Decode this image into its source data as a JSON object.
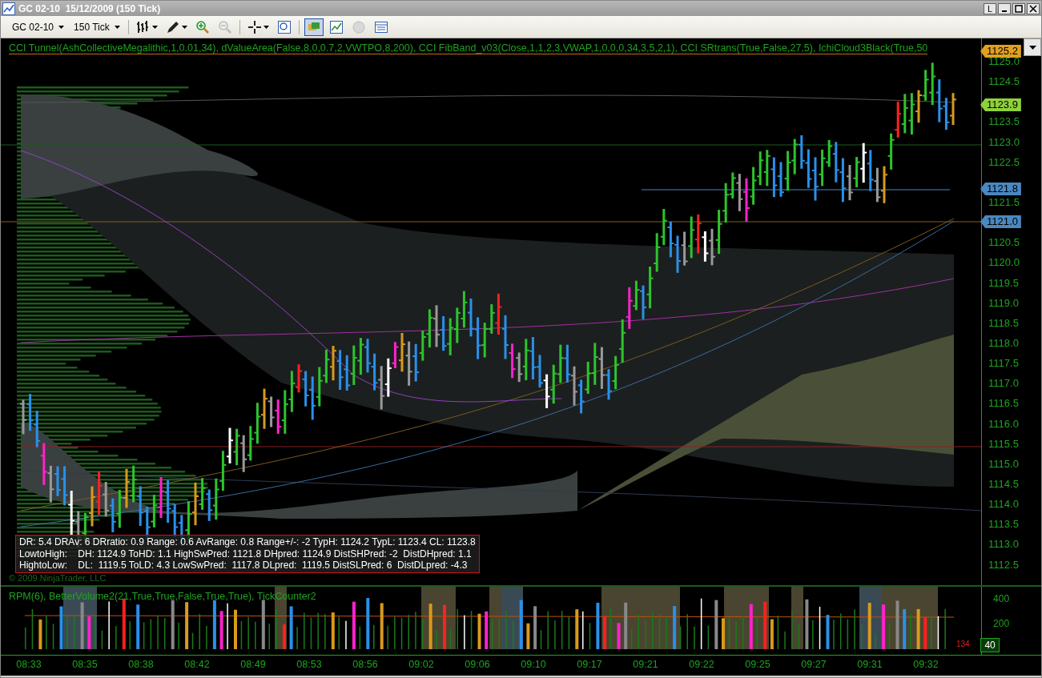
{
  "window": {
    "title": "GC 02-10  15/12/2009 (150 Tick)",
    "link_button": "L"
  },
  "toolbar": {
    "instrument": "GC 02-10",
    "interval": "150 Tick",
    "tools": [
      {
        "kind": "bars",
        "dropdown": true,
        "selected": false,
        "disabled": false
      },
      {
        "kind": "pencil",
        "dropdown": true,
        "selected": false,
        "disabled": false
      },
      {
        "kind": "zoom-in",
        "dropdown": false,
        "selected": false,
        "disabled": false
      },
      {
        "kind": "zoom-out",
        "dropdown": false,
        "selected": false,
        "disabled": true
      },
      {
        "kind": "crosshair",
        "dropdown": true,
        "selected": false,
        "disabled": false
      },
      {
        "kind": "zoom-box",
        "dropdown": false,
        "selected": false,
        "disabled": false
      },
      {
        "kind": "data-box",
        "dropdown": false,
        "selected": true,
        "disabled": false
      },
      {
        "kind": "chart",
        "dropdown": false,
        "selected": false,
        "disabled": false
      },
      {
        "kind": "coin",
        "dropdown": false,
        "selected": false,
        "disabled": true
      },
      {
        "kind": "table",
        "dropdown": false,
        "selected": false,
        "disabled": false
      }
    ]
  },
  "price_panel": {
    "indicators": "CCI Tunnel(AshCollectiveMegalithic,1,0.01,34),  dValueArea(False,8,0,0.7,2,VWTPO,8,200),  CCI FibBand_v03(Close,1,1,2,3,VWAP,1,0,0,0,34,3,5,2,1),  CCI SRtrans(True,False,27,5),  IchiCloud3Black(True,50",
    "price_tags": [
      {
        "label": "1125.2",
        "color": "#e0a020"
      },
      {
        "label": "1123.9",
        "color": "#8fd13a"
      },
      {
        "label": "1121.8",
        "color": "#4a88c0"
      },
      {
        "label": "1121.0",
        "color": "#4a88c0"
      }
    ],
    "price_axis": [
      "1125.0",
      "1124.5",
      "1123.5",
      "1123.0",
      "1122.5",
      "1121.5",
      "1120.5",
      "1120.0",
      "1119.5",
      "1119.0",
      "1118.5",
      "1118.0",
      "1117.5",
      "1117.0",
      "1116.5",
      "1116.0",
      "1115.5",
      "1115.0",
      "1114.5",
      "1114.0",
      "1113.5",
      "1113.0",
      "1112.5"
    ],
    "info_box": [
      "DR: 5.4 DRAv: 6 DRratio: 0.9 Range: 0.6 AvRange: 0.8 Range+/-: -2 TypH: 1124.2 TypL: 1123.4 CL: 1123.8",
      "LowtoHigh:    DH: 1124.9 ToHD: 1.1 HighSwPred: 1121.8 DHpred: 1124.9 DistSHPred: -2  DistDHpred: 1.1",
      "HightoLow:    DL:  1119.5 ToLD: 4.3 LowSwPred:  1117.8 DLpred:  1119.5 DistSLPred: 6  DistDLpred: -4.3"
    ],
    "copyright": "© 2009 NinjaTrader, LLC"
  },
  "volume_panel": {
    "indicators": "RPM(6),  BetterVolume2(21,True,True,False,True,True),  TickCounter2",
    "axis": [
      "400",
      "200"
    ],
    "volume_tag": "40",
    "tick_count": "134"
  },
  "time_axis": [
    "08:33",
    "08:35",
    "08:38",
    "08:42",
    "08:49",
    "08:53",
    "08:56",
    "09:02",
    "09:06",
    "09:10",
    "09:17",
    "09:21",
    "09:22",
    "09:25",
    "09:27",
    "09:31",
    "09:32"
  ]
}
